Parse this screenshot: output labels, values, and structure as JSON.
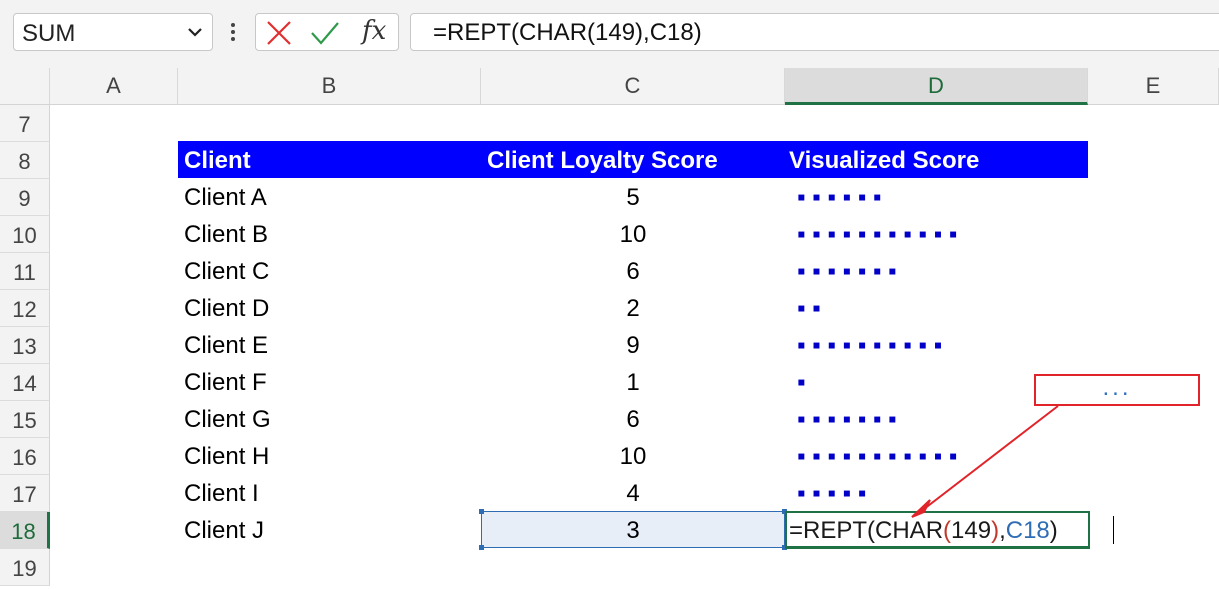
{
  "formula_bar": {
    "name_box": "SUM",
    "formula": "=REPT(CHAR(149),C18)"
  },
  "columns": [
    "A",
    "B",
    "C",
    "D",
    "E"
  ],
  "rows": [
    "7",
    "8",
    "9",
    "10",
    "11",
    "12",
    "13",
    "14",
    "15",
    "16",
    "17",
    "18",
    "19"
  ],
  "table": {
    "headers": [
      "Client",
      "Client Loyalty Score",
      "Visualized Score"
    ],
    "rows": [
      {
        "client": "Client A",
        "score": "5",
        "visual": "▪ ▪ ▪ ▪ ▪ ▪"
      },
      {
        "client": "Client B",
        "score": "10",
        "visual": "▪ ▪ ▪ ▪ ▪ ▪ ▪ ▪ ▪ ▪ ▪"
      },
      {
        "client": "Client C",
        "score": "6",
        "visual": "▪ ▪ ▪ ▪ ▪ ▪ ▪"
      },
      {
        "client": "Client D",
        "score": "2",
        "visual": "▪ ▪"
      },
      {
        "client": "Client E",
        "score": "9",
        "visual": "▪ ▪ ▪ ▪ ▪ ▪ ▪ ▪ ▪ ▪"
      },
      {
        "client": "Client F",
        "score": "1",
        "visual": "▪"
      },
      {
        "client": "Client G",
        "score": "6",
        "visual": "▪ ▪ ▪ ▪ ▪ ▪ ▪"
      },
      {
        "client": "Client H",
        "score": "10",
        "visual": "▪ ▪ ▪ ▪ ▪ ▪ ▪ ▪ ▪ ▪ ▪"
      },
      {
        "client": "Client I",
        "score": "4",
        "visual": "▪ ▪ ▪ ▪ ▪"
      },
      {
        "client": "Client J",
        "score": "3",
        "visual": ""
      }
    ]
  },
  "editing_cell": {
    "parts": [
      "=REPT(",
      "CHAR",
      "(",
      "149",
      ")",
      ",",
      "C18",
      ")"
    ]
  },
  "callout": {
    "text": "..."
  },
  "colors": {
    "header_fill": "#0000ff",
    "dots": "#0000c8",
    "selection_green": "#1f7244",
    "callout_border": "#e0242a"
  }
}
